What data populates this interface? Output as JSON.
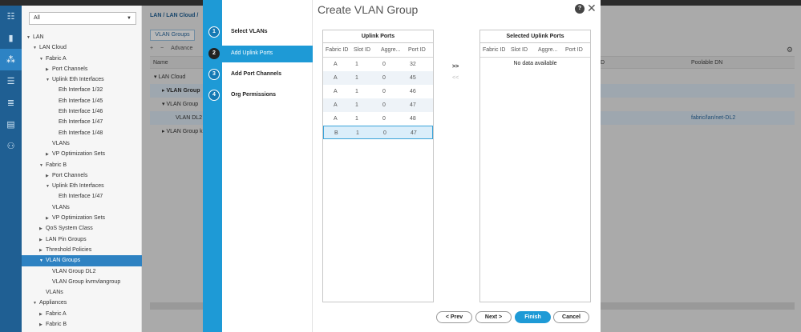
{
  "nav": {
    "filter": "All",
    "tree": [
      {
        "label": "LAN",
        "depth": 0,
        "arrow": "down"
      },
      {
        "label": "LAN Cloud",
        "depth": 1,
        "arrow": "down"
      },
      {
        "label": "Fabric A",
        "depth": 2,
        "arrow": "down"
      },
      {
        "label": "Port Channels",
        "depth": 3,
        "arrow": "right"
      },
      {
        "label": "Uplink Eth Interfaces",
        "depth": 3,
        "arrow": "down"
      },
      {
        "label": "Eth Interface 1/32",
        "depth": 4,
        "arrow": ""
      },
      {
        "label": "Eth Interface 1/45",
        "depth": 4,
        "arrow": ""
      },
      {
        "label": "Eth Interface 1/46",
        "depth": 4,
        "arrow": ""
      },
      {
        "label": "Eth Interface 1/47",
        "depth": 4,
        "arrow": ""
      },
      {
        "label": "Eth Interface 1/48",
        "depth": 4,
        "arrow": ""
      },
      {
        "label": "VLANs",
        "depth": 3,
        "arrow": ""
      },
      {
        "label": "VP Optimization Sets",
        "depth": 3,
        "arrow": "right"
      },
      {
        "label": "Fabric B",
        "depth": 2,
        "arrow": "down"
      },
      {
        "label": "Port Channels",
        "depth": 3,
        "arrow": "right"
      },
      {
        "label": "Uplink Eth Interfaces",
        "depth": 3,
        "arrow": "down"
      },
      {
        "label": "Eth Interface 1/47",
        "depth": 4,
        "arrow": ""
      },
      {
        "label": "VLANs",
        "depth": 3,
        "arrow": ""
      },
      {
        "label": "VP Optimization Sets",
        "depth": 3,
        "arrow": "right"
      },
      {
        "label": "QoS System Class",
        "depth": 2,
        "arrow": "right"
      },
      {
        "label": "LAN Pin Groups",
        "depth": 2,
        "arrow": "right"
      },
      {
        "label": "Threshold Policies",
        "depth": 2,
        "arrow": "right"
      },
      {
        "label": "VLAN Groups",
        "depth": 2,
        "arrow": "down",
        "selected": true
      },
      {
        "label": "VLAN Group DL2",
        "depth": 3,
        "arrow": ""
      },
      {
        "label": "VLAN Group kvmvlangroup",
        "depth": 3,
        "arrow": ""
      },
      {
        "label": "VLANs",
        "depth": 2,
        "arrow": ""
      },
      {
        "label": "Appliances",
        "depth": 1,
        "arrow": "down"
      },
      {
        "label": "Fabric A",
        "depth": 2,
        "arrow": "right"
      },
      {
        "label": "Fabric B",
        "depth": 2,
        "arrow": "right"
      }
    ]
  },
  "main": {
    "breadcrumb": "LAN / LAN Cloud /",
    "tab": "VLAN Groups",
    "toolbar": {
      "add": "+",
      "remove": "−",
      "advanced": "Advance"
    },
    "columns": {
      "name": "Name",
      "d": "D",
      "poolable_dn": "Poolable DN"
    },
    "rows": {
      "lan_cloud": "LAN Cloud",
      "vlan_group_1": "VLAN Group",
      "vlan_group_2": "VLAN Group",
      "vlan_dl2": "VLAN DL2",
      "vlan_group_3": "VLAN Group k",
      "dl2_dn": "fabric/lan/net-DL2"
    }
  },
  "wizard": {
    "steps": [
      {
        "num": "1",
        "label": "Select VLANs"
      },
      {
        "num": "2",
        "label": "Add Uplink Ports",
        "active": true
      },
      {
        "num": "3",
        "label": "Add Port Channels"
      },
      {
        "num": "4",
        "label": "Org Permissions"
      }
    ],
    "title": "Create VLAN Group",
    "help": "?",
    "close": "✕",
    "uplink": {
      "title": "Uplink Ports",
      "headers": [
        "Fabric ID",
        "Slot ID",
        "Aggre...",
        "Port ID"
      ],
      "rows": [
        [
          "A",
          "1",
          "0",
          "32"
        ],
        [
          "A",
          "1",
          "0",
          "45"
        ],
        [
          "A",
          "1",
          "0",
          "46"
        ],
        [
          "A",
          "1",
          "0",
          "47"
        ],
        [
          "A",
          "1",
          "0",
          "48"
        ],
        [
          "B",
          "1",
          "0",
          "47"
        ]
      ]
    },
    "selected": {
      "title": "Selected Uplink Ports",
      "headers": [
        "Fabric ID",
        "Slot ID",
        "Aggre...",
        "Port ID"
      ],
      "empty": "No data available"
    },
    "move_right": ">>",
    "move_left": "<<",
    "buttons": {
      "prev": "< Prev",
      "next": "Next >",
      "finish": "Finish",
      "cancel": "Cancel"
    }
  }
}
